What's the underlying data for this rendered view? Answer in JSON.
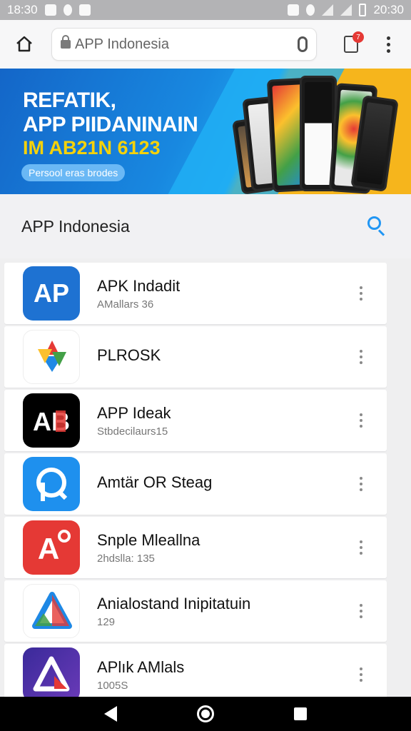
{
  "status_bar": {
    "time_left": "18:30",
    "time_right": "20:30"
  },
  "browser": {
    "url": "APP Indonesia",
    "tab_count": "7"
  },
  "banner": {
    "line1": "REFATIK,",
    "line2": "APP PIIDANINAIN",
    "code": "IM AB21N 6123",
    "pill": "Persool eras brodes"
  },
  "section": {
    "heading": "APP Indonesia"
  },
  "apps": [
    {
      "name": "APK Indadit",
      "sub": "AMallars 36",
      "icon": "ap-icon",
      "color": "#1e72d2"
    },
    {
      "name": "PLROSK",
      "sub": "",
      "icon": "multicolor-star-icon",
      "color": "#ffffff"
    },
    {
      "name": "APP Ideak",
      "sub": "Stbdecilaurs15",
      "icon": "ab-icon",
      "color": "#000000"
    },
    {
      "name": "Amtär OR Steag",
      "sub": "",
      "icon": "p-arrow-icon",
      "color": "#1e90ee"
    },
    {
      "name": "Snple Mleallna",
      "sub": "2hdslla: 135",
      "icon": "a-degree-icon",
      "color": "#e53935"
    },
    {
      "name": "Anialostand Inipitatuin",
      "sub": "129",
      "icon": "triangle-icon",
      "color": "#ffffff"
    },
    {
      "name": "APlık AMlals",
      "sub": "1005S",
      "icon": "a-triangle-icon",
      "color": "#4a2aa0"
    }
  ]
}
